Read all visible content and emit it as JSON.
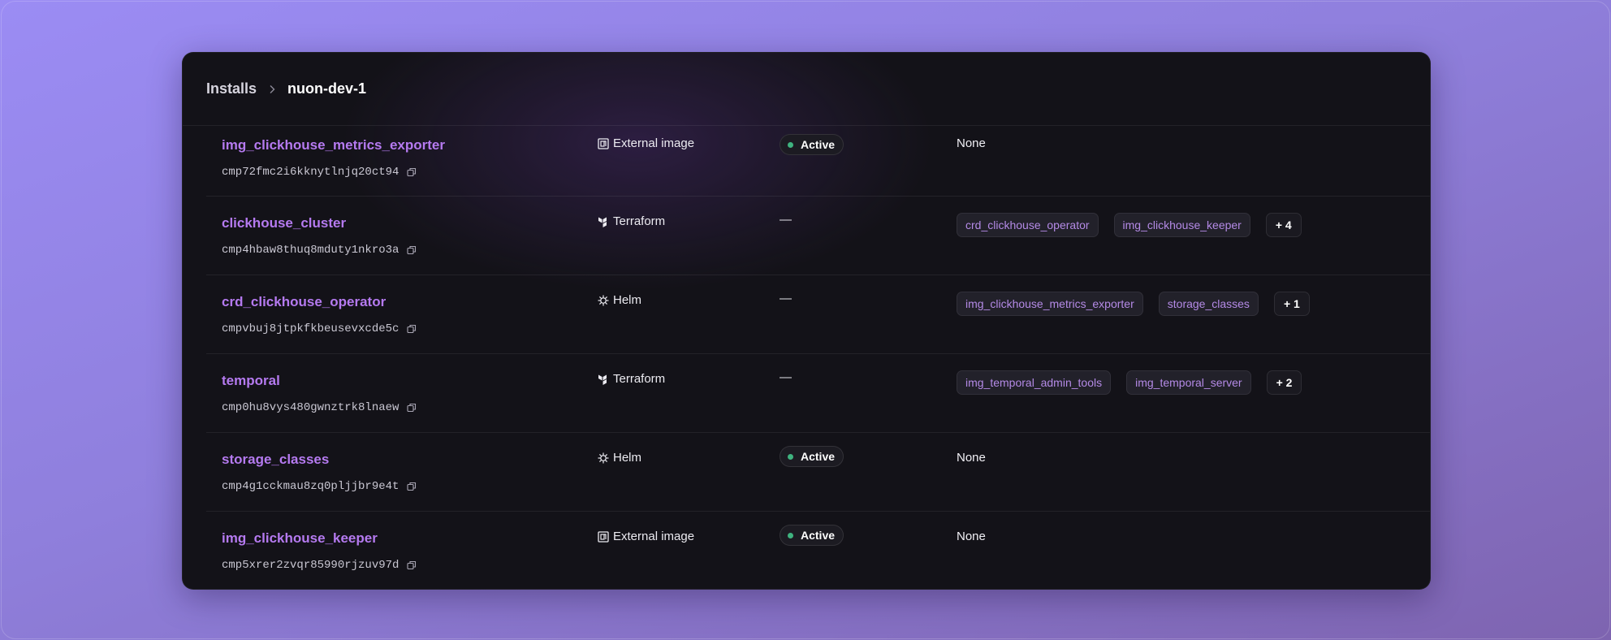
{
  "breadcrumb": {
    "parent": "Installs",
    "current": "nuon-dev-1"
  },
  "components": [
    {
      "name": "img_clickhouse_metrics_exporter",
      "id": "cmp72fmc2i6kknytlnjq20ct94",
      "type": "External image",
      "type_icon": "external-image-icon",
      "status": "Active",
      "dependencies": [],
      "deps_none": "None",
      "more": ""
    },
    {
      "name": "clickhouse_cluster",
      "id": "cmp4hbaw8thuq8mduty1nkro3a",
      "type": "Terraform",
      "type_icon": "terraform-icon",
      "status": "",
      "status_dash": "—",
      "dependencies": [
        "crd_clickhouse_operator",
        "img_clickhouse_keeper"
      ],
      "more": "+ 4"
    },
    {
      "name": "crd_clickhouse_operator",
      "id": "cmpvbuj8jtpkfkbeusevxcde5c",
      "type": "Helm",
      "type_icon": "helm-icon",
      "status": "",
      "status_dash": "—",
      "dependencies": [
        "img_clickhouse_metrics_exporter",
        "storage_classes"
      ],
      "more": "+ 1"
    },
    {
      "name": "temporal",
      "id": "cmp0hu8vys480gwnztrk8lnaew",
      "type": "Terraform",
      "type_icon": "terraform-icon",
      "status": "",
      "status_dash": "—",
      "dependencies": [
        "img_temporal_admin_tools",
        "img_temporal_server"
      ],
      "more": "+ 2"
    },
    {
      "name": "storage_classes",
      "id": "cmp4g1cckmau8zq0pljjbr9e4t",
      "type": "Helm",
      "type_icon": "helm-icon",
      "status": "Active",
      "dependencies": [],
      "deps_none": "None",
      "more": ""
    },
    {
      "name": "img_clickhouse_keeper",
      "id": "cmp5xrer2zvqr85990rjzuv97d",
      "type": "External image",
      "type_icon": "external-image-icon",
      "status": "Active",
      "dependencies": [],
      "deps_none": "None",
      "more": ""
    }
  ],
  "colors": {
    "accent": "#b57af0",
    "status_active": "#3fb37f",
    "panel": "#131218"
  }
}
